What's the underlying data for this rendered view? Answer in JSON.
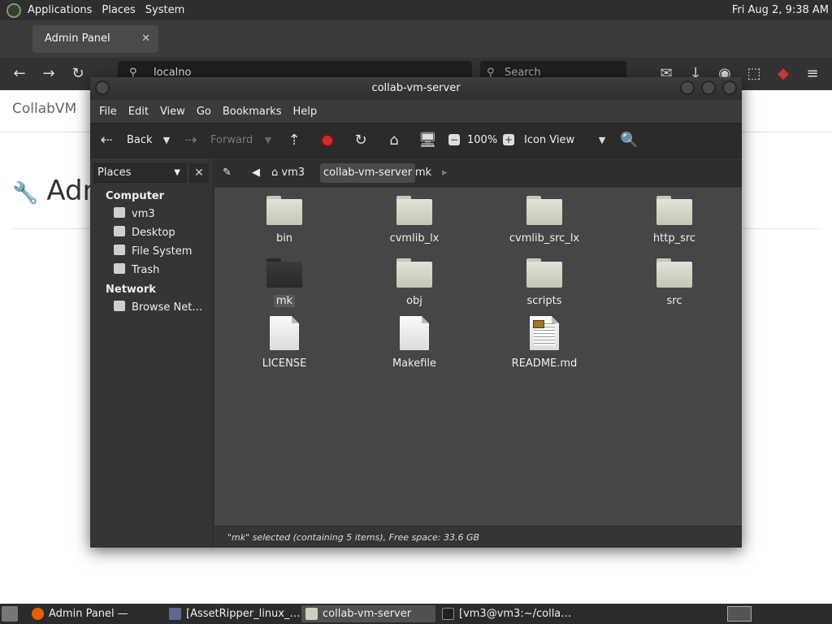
{
  "top_panel": {
    "menus": [
      "Applications",
      "Places",
      "System"
    ],
    "clock": "Fri Aug  2, 9:38 AM"
  },
  "browser": {
    "active_tab": "Admin Panel",
    "url": "localno",
    "search_placeholder": "Search",
    "page_brand": "CollabVM",
    "page_title": "Adm"
  },
  "file_manager": {
    "title": "collab-vm-server",
    "menubar": [
      "File",
      "Edit",
      "View",
      "Go",
      "Bookmarks",
      "Help"
    ],
    "toolbar": {
      "back": "Back",
      "forward": "Forward",
      "zoom": "100%",
      "view_mode": "Icon View"
    },
    "sidebar": {
      "selector": "Places",
      "sections": [
        {
          "heading": "Computer",
          "items": [
            "vm3",
            "Desktop",
            "File System",
            "Trash"
          ]
        },
        {
          "heading": "Network",
          "items": [
            "Browse Net…"
          ]
        }
      ]
    },
    "pathbar": [
      "vm3",
      "collab-vm-server",
      "mk"
    ],
    "items": [
      {
        "name": "bin",
        "kind": "folder"
      },
      {
        "name": "cvmlib_lx",
        "kind": "folder"
      },
      {
        "name": "cvmlib_src_lx",
        "kind": "folder"
      },
      {
        "name": "http_src",
        "kind": "folder"
      },
      {
        "name": "mk",
        "kind": "folder",
        "selected": true
      },
      {
        "name": "obj",
        "kind": "folder"
      },
      {
        "name": "scripts",
        "kind": "folder"
      },
      {
        "name": "src",
        "kind": "folder"
      },
      {
        "name": "LICENSE",
        "kind": "file"
      },
      {
        "name": "Makefile",
        "kind": "file"
      },
      {
        "name": "README.md",
        "kind": "document"
      }
    ],
    "status": "\"mk\" selected (containing 5 items), Free space: 33.6 GB"
  },
  "taskbar": {
    "tasks": [
      {
        "label": "Admin Panel — Moz…",
        "active": false
      },
      {
        "label": "[AssetRipper_linux_…",
        "active": false
      },
      {
        "label": "collab-vm-server",
        "active": true
      },
      {
        "label": "[vm3@vm3:~/colla…",
        "active": false
      }
    ]
  }
}
